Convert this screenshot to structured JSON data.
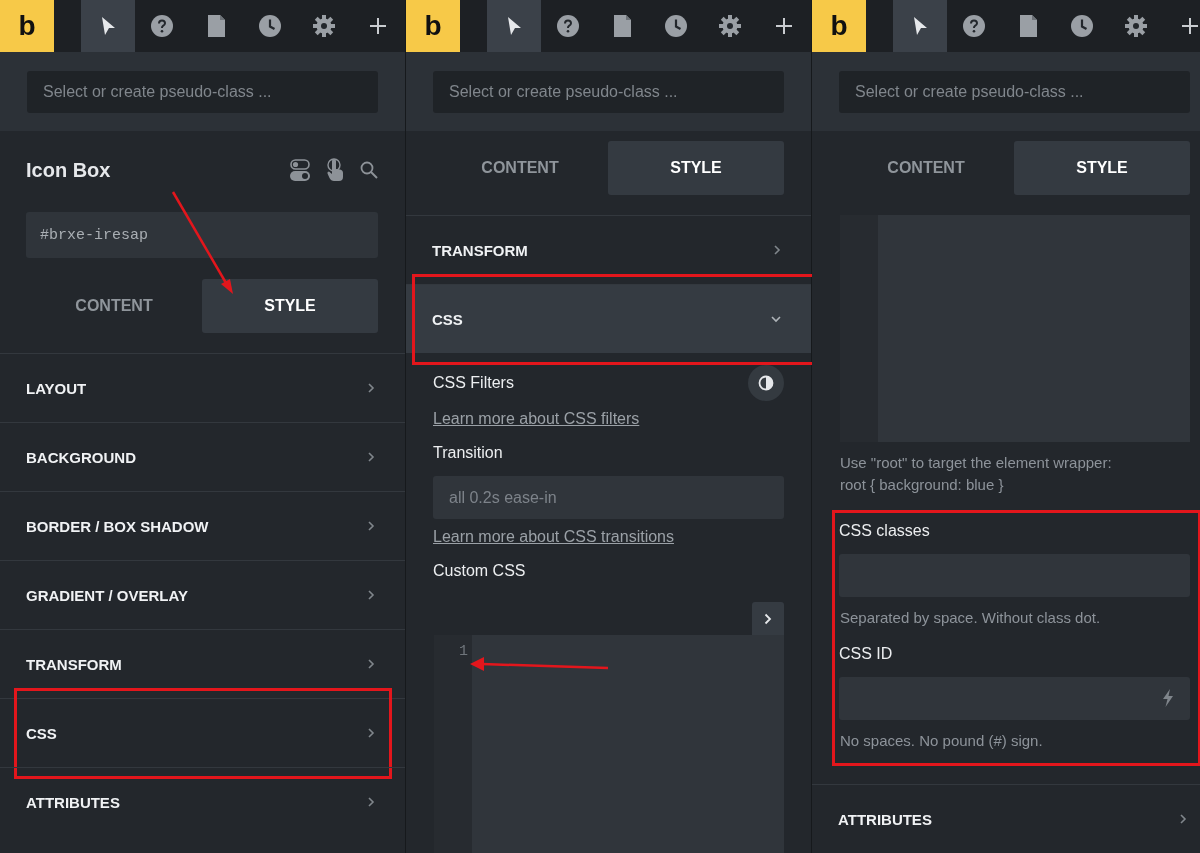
{
  "panels": [
    {
      "toolbar": {
        "logo": "b",
        "tools": [
          {
            "kind": "cursor",
            "selected": true
          },
          {
            "kind": "help",
            "selected": false
          },
          {
            "kind": "page",
            "selected": false
          },
          {
            "kind": "history",
            "selected": false
          },
          {
            "kind": "settings",
            "selected": false
          },
          {
            "kind": "add",
            "selected": false
          }
        ]
      },
      "pseudo_class": {
        "placeholder": "Select or create pseudo-class ..."
      },
      "blocks": [
        {
          "kind": "element-header",
          "title": "Icon Box"
        },
        {
          "kind": "id-field",
          "value": "#brxe-iresap"
        },
        {
          "kind": "tabs",
          "tabs": [
            {
              "label": "CONTENT",
              "selected": false
            },
            {
              "label": "STYLE",
              "selected": true
            }
          ]
        },
        {
          "kind": "section",
          "label": "LAYOUT",
          "expanded": false,
          "highlighted": false
        },
        {
          "kind": "section",
          "label": "BACKGROUND",
          "expanded": false,
          "highlighted": false
        },
        {
          "kind": "section",
          "label": "BORDER / BOX SHADOW",
          "expanded": false,
          "highlighted": false
        },
        {
          "kind": "section",
          "label": "GRADIENT / OVERLAY",
          "expanded": false,
          "highlighted": false
        },
        {
          "kind": "section",
          "label": "TRANSFORM",
          "expanded": false,
          "highlighted": false
        },
        {
          "kind": "section",
          "label": "CSS",
          "expanded": false,
          "highlighted": true
        },
        {
          "kind": "section",
          "label": "ATTRIBUTES",
          "expanded": false,
          "highlighted": false
        }
      ]
    },
    {
      "toolbar": {
        "logo": "b",
        "tools": [
          {
            "kind": "cursor",
            "selected": true
          },
          {
            "kind": "help",
            "selected": false
          },
          {
            "kind": "page",
            "selected": false
          },
          {
            "kind": "history",
            "selected": false
          },
          {
            "kind": "settings",
            "selected": false
          },
          {
            "kind": "add",
            "selected": false
          }
        ]
      },
      "pseudo_class": {
        "placeholder": "Select or create pseudo-class ..."
      },
      "blocks": [
        {
          "kind": "tabs",
          "tabs": [
            {
              "label": "CONTENT",
              "selected": false
            },
            {
              "label": "STYLE",
              "selected": true
            }
          ]
        },
        {
          "kind": "section",
          "label": "TRANSFORM",
          "expanded": false,
          "highlighted": false
        },
        {
          "kind": "section",
          "label": "CSS",
          "expanded": true,
          "highlighted": true
        },
        {
          "kind": "control-label-with-button",
          "text": "CSS Filters"
        },
        {
          "kind": "link",
          "text": "Learn more about CSS filters"
        },
        {
          "kind": "control-label",
          "text": "Transition"
        },
        {
          "kind": "text-field",
          "placeholder": "all 0.2s ease-in"
        },
        {
          "kind": "link",
          "text": "Learn more about CSS transitions"
        },
        {
          "kind": "control-label",
          "text": "Custom CSS"
        },
        {
          "kind": "expandable-code-editor",
          "line_numbers": [
            "1"
          ]
        }
      ]
    },
    {
      "toolbar": {
        "logo": "b",
        "tools": [
          {
            "kind": "cursor",
            "selected": true
          },
          {
            "kind": "help",
            "selected": false
          },
          {
            "kind": "page",
            "selected": false
          },
          {
            "kind": "history",
            "selected": false
          },
          {
            "kind": "settings",
            "selected": false
          },
          {
            "kind": "add",
            "selected": false
          }
        ]
      },
      "pseudo_class": {
        "placeholder": "Select or create pseudo-class ..."
      },
      "blocks": [
        {
          "kind": "tabs",
          "tabs": [
            {
              "label": "CONTENT",
              "selected": false
            },
            {
              "label": "STYLE",
              "selected": true
            }
          ]
        },
        {
          "kind": "code-editor"
        },
        {
          "kind": "hint",
          "text": "Use \"root\" to target the element wrapper:"
        },
        {
          "kind": "hint",
          "text": "root { background: blue }"
        },
        {
          "kind": "group",
          "highlighted": true,
          "blocks": [
            {
              "kind": "control-label",
              "text": "CSS classes"
            },
            {
              "kind": "text-field"
            },
            {
              "kind": "hint",
              "text": "Separated by space. Without class dot."
            },
            {
              "kind": "control-label",
              "text": "CSS ID"
            },
            {
              "kind": "action-field"
            },
            {
              "kind": "hint",
              "text": "No spaces. No pound (#) sign."
            }
          ]
        },
        {
          "kind": "section",
          "label": "ATTRIBUTES",
          "expanded": false,
          "highlighted": false
        }
      ]
    }
  ]
}
